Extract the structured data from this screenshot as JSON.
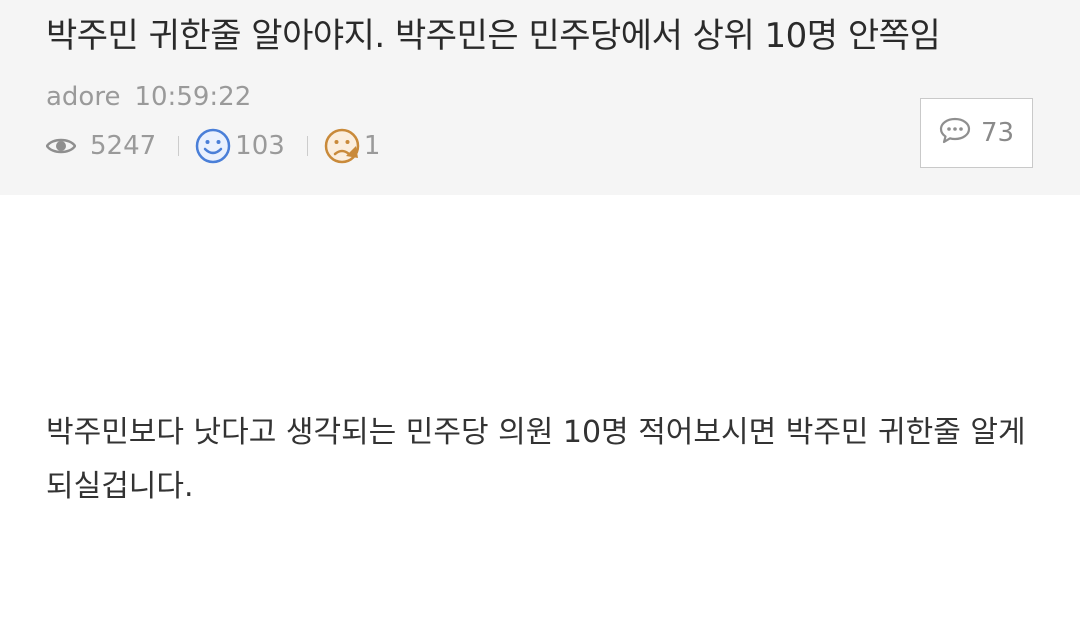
{
  "post": {
    "title": "박주민 귀한줄 알아야지. 박주민은 민주당에서 상위 10명 안쪽임",
    "author": "adore",
    "time": "10:59:22",
    "views": "5247",
    "likes": "103",
    "dislikes": "1",
    "comments": "73",
    "body": "박주민보다 낫다고 생각되는 민주당 의원 10명 적어보시면 박주민 귀한줄 알게 되실겁니다."
  },
  "icons": {
    "views": "eye-icon",
    "likes": "smile-face-icon",
    "dislikes": "dislike-face-icon",
    "comments": "speech-bubble-icon"
  },
  "colors": {
    "header_bg": "#f5f5f5",
    "like_icon": "#4a7fd8",
    "dislike_icon": "#c98a3a",
    "meta_text": "#9a9a9a"
  }
}
